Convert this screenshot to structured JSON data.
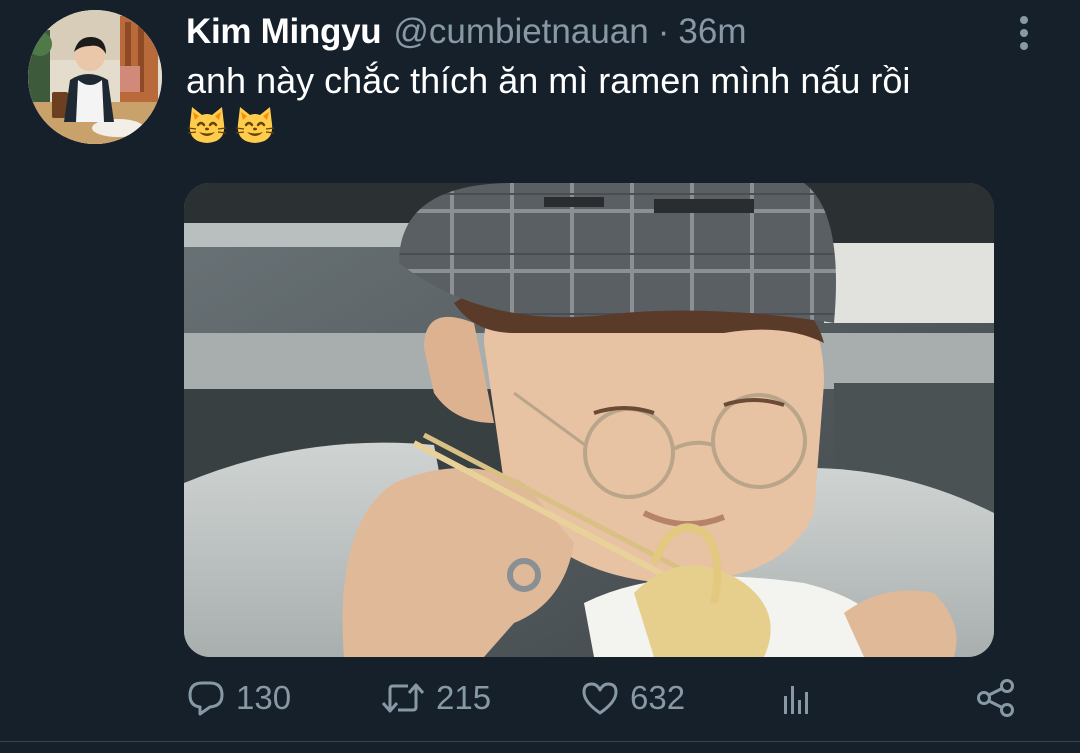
{
  "tweet": {
    "author": {
      "display_name": "Kim Mingyu",
      "handle": "@cumbietnauan",
      "separator": "·",
      "time": "36m",
      "avatar_icon": "profile-photo"
    },
    "text": "anh này chắc thích ăn mì ramen mình nấu rồi",
    "emojis": [
      "smiling-cat-face",
      "smiling-cat-face"
    ],
    "media": {
      "type": "photo",
      "subject": "person-eating-noodles"
    },
    "actions": {
      "reply": {
        "icon": "reply-icon",
        "count": "130"
      },
      "retweet": {
        "icon": "retweet-icon",
        "count": "215"
      },
      "like": {
        "icon": "heart-icon",
        "count": "632"
      },
      "analytics": {
        "icon": "analytics-icon"
      },
      "share": {
        "icon": "share-icon"
      }
    },
    "more_menu_icon": "more-vertical-icon"
  },
  "colors": {
    "background": "#15202b",
    "primary_text": "#ffffff",
    "secondary_text": "#8899a6",
    "divider": "#38444d"
  }
}
